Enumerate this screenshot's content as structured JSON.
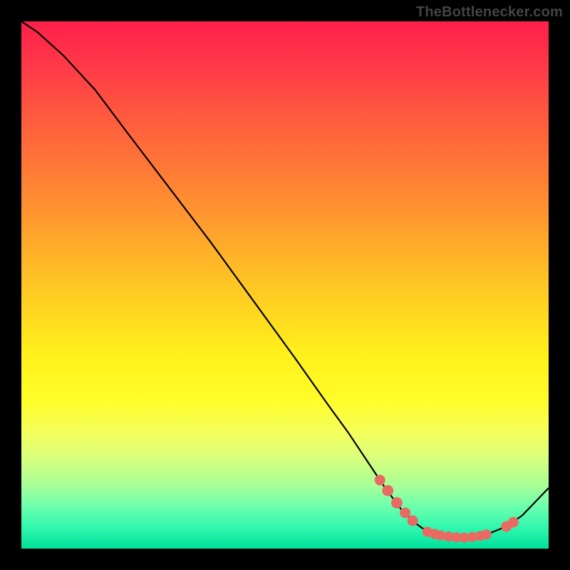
{
  "attribution": "TheBottlenecker.com",
  "chart_data": {
    "type": "line",
    "title": "",
    "xlabel": "",
    "ylabel": "",
    "x_range": [
      0,
      100
    ],
    "y_range": [
      0,
      100
    ],
    "curve": [
      {
        "x": 0,
        "y": 100
      },
      {
        "x": 3,
        "y": 98
      },
      {
        "x": 8,
        "y": 93.5
      },
      {
        "x": 14,
        "y": 87
      },
      {
        "x": 20,
        "y": 79
      },
      {
        "x": 28,
        "y": 68.5
      },
      {
        "x": 36,
        "y": 58
      },
      {
        "x": 44,
        "y": 47
      },
      {
        "x": 52,
        "y": 36
      },
      {
        "x": 58,
        "y": 27.5
      },
      {
        "x": 62,
        "y": 22
      },
      {
        "x": 66,
        "y": 16
      },
      {
        "x": 69,
        "y": 11.5
      },
      {
        "x": 72,
        "y": 7.5
      },
      {
        "x": 74.5,
        "y": 5
      },
      {
        "x": 77,
        "y": 3.2
      },
      {
        "x": 80,
        "y": 2.3
      },
      {
        "x": 83,
        "y": 2.0
      },
      {
        "x": 86,
        "y": 2.2
      },
      {
        "x": 89,
        "y": 3.0
      },
      {
        "x": 92,
        "y": 4.2
      },
      {
        "x": 95,
        "y": 6.3
      },
      {
        "x": 100,
        "y": 11.5
      }
    ],
    "markers": [
      {
        "x": 68.0,
        "y": 13.0,
        "r": 1.1
      },
      {
        "x": 69.5,
        "y": 11.0,
        "r": 1.2
      },
      {
        "x": 71.2,
        "y": 8.7,
        "r": 1.2
      },
      {
        "x": 72.8,
        "y": 6.8,
        "r": 1.1
      },
      {
        "x": 74.2,
        "y": 5.3,
        "r": 1.1
      },
      {
        "x": 77.0,
        "y": 3.2,
        "r": 1.0
      },
      {
        "x": 78.3,
        "y": 2.8,
        "r": 1.0
      },
      {
        "x": 79.5,
        "y": 2.5,
        "r": 1.0
      },
      {
        "x": 81.0,
        "y": 2.3,
        "r": 1.0
      },
      {
        "x": 82.5,
        "y": 2.15,
        "r": 1.0
      },
      {
        "x": 84.0,
        "y": 2.1,
        "r": 1.0
      },
      {
        "x": 85.5,
        "y": 2.2,
        "r": 1.0
      },
      {
        "x": 87.0,
        "y": 2.4,
        "r": 1.0
      },
      {
        "x": 88.2,
        "y": 2.7,
        "r": 1.0
      },
      {
        "x": 92.0,
        "y": 4.2,
        "r": 1.1
      },
      {
        "x": 93.3,
        "y": 5.0,
        "r": 1.1
      }
    ],
    "colors": {
      "gradient_top": "#ff1f4b",
      "gradient_mid": "#fff01b",
      "gradient_bottom": "#00e19c",
      "curve": "#000000",
      "marker": "#e96a62",
      "frame": "#000000"
    }
  }
}
